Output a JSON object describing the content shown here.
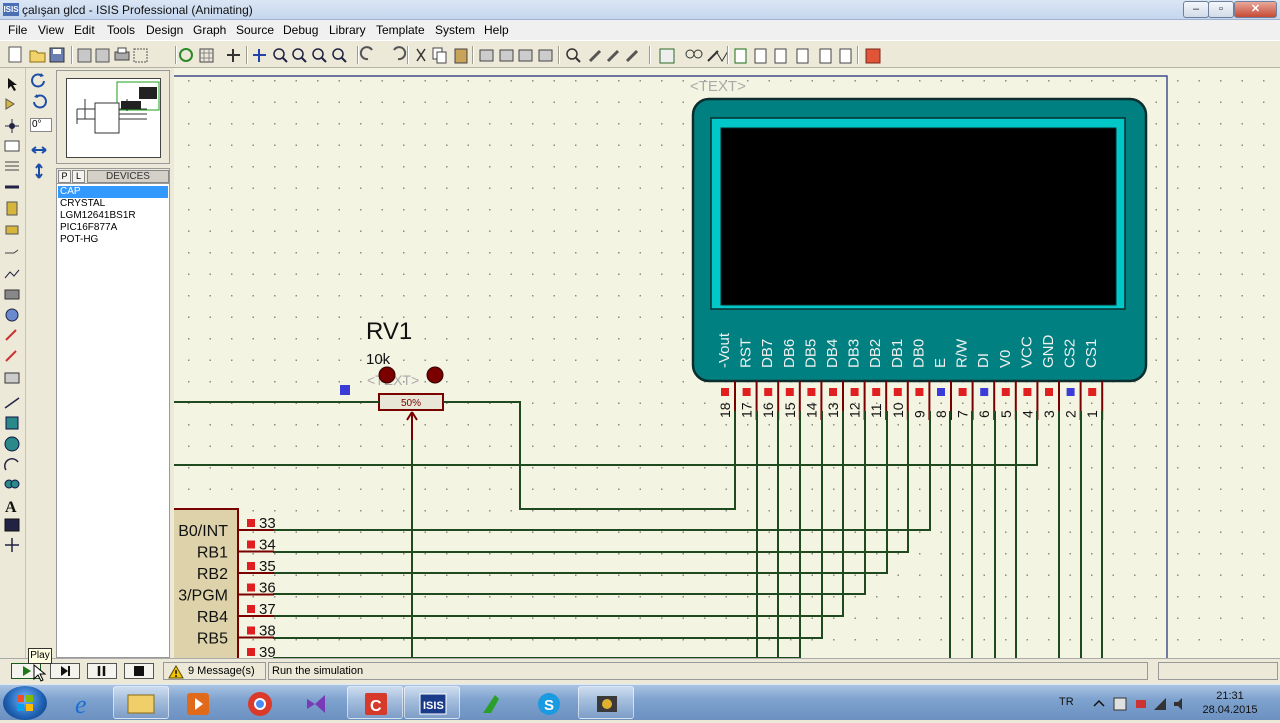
{
  "window": {
    "title": "çalışan glcd - ISIS Professional (Animating)",
    "icon": "ISIS"
  },
  "menu": [
    "File",
    "View",
    "Edit",
    "Tools",
    "Design",
    "Graph",
    "Source",
    "Debug",
    "Library",
    "Template",
    "System",
    "Help"
  ],
  "sidebar": {
    "angle": "0°",
    "tab_p": "P",
    "tab_l": "L",
    "devices_label": "DEVICES",
    "devices": [
      "CAP",
      "CRYSTAL",
      "LGM12641BS1R",
      "PIC16F877A",
      "POT-HG"
    ],
    "selected_device": "CAP"
  },
  "schematic": {
    "text_placeholder": "<TEXT>",
    "pot_ref": "RV1",
    "pot_value": "10k",
    "pot_text": "<TEXT>",
    "pot_position": "50%",
    "lcd_pins": [
      {
        "name": "-Vout",
        "num": "18"
      },
      {
        "name": "RST",
        "num": "17"
      },
      {
        "name": "DB7",
        "num": "16"
      },
      {
        "name": "DB6",
        "num": "15"
      },
      {
        "name": "DB5",
        "num": "14"
      },
      {
        "name": "DB4",
        "num": "13"
      },
      {
        "name": "DB3",
        "num": "12"
      },
      {
        "name": "DB2",
        "num": "11"
      },
      {
        "name": "DB1",
        "num": "10"
      },
      {
        "name": "DB0",
        "num": "9"
      },
      {
        "name": "E",
        "num": "8"
      },
      {
        "name": "R/W",
        "num": "7"
      },
      {
        "name": "DI",
        "num": "6"
      },
      {
        "name": "V0",
        "num": "5"
      },
      {
        "name": "VCC",
        "num": "4"
      },
      {
        "name": "GND",
        "num": "3"
      },
      {
        "name": "CS2",
        "num": "2"
      },
      {
        "name": "CS1",
        "num": "1"
      }
    ],
    "mcu_pins": [
      {
        "name": "B0/INT",
        "num": "33"
      },
      {
        "name": "RB1",
        "num": "34"
      },
      {
        "name": "RB2",
        "num": "35"
      },
      {
        "name": "3/PGM",
        "num": "36"
      },
      {
        "name": "RB4",
        "num": "37"
      },
      {
        "name": "RB5",
        "num": "38"
      },
      {
        "name": "",
        "num": "39"
      }
    ]
  },
  "simulation": {
    "messages": "9 Message(s)",
    "status": "Run the simulation",
    "tooltip": "Play"
  },
  "tray": {
    "lang": "TR",
    "time": "21:31",
    "date": "28.04.2015"
  },
  "colors": {
    "lcd_bezel": "#008080",
    "lcd_frame": "#00c8c8",
    "wire": "#1f4a1f",
    "pin": "#8b1010",
    "canvas": "#f4f4e2"
  }
}
